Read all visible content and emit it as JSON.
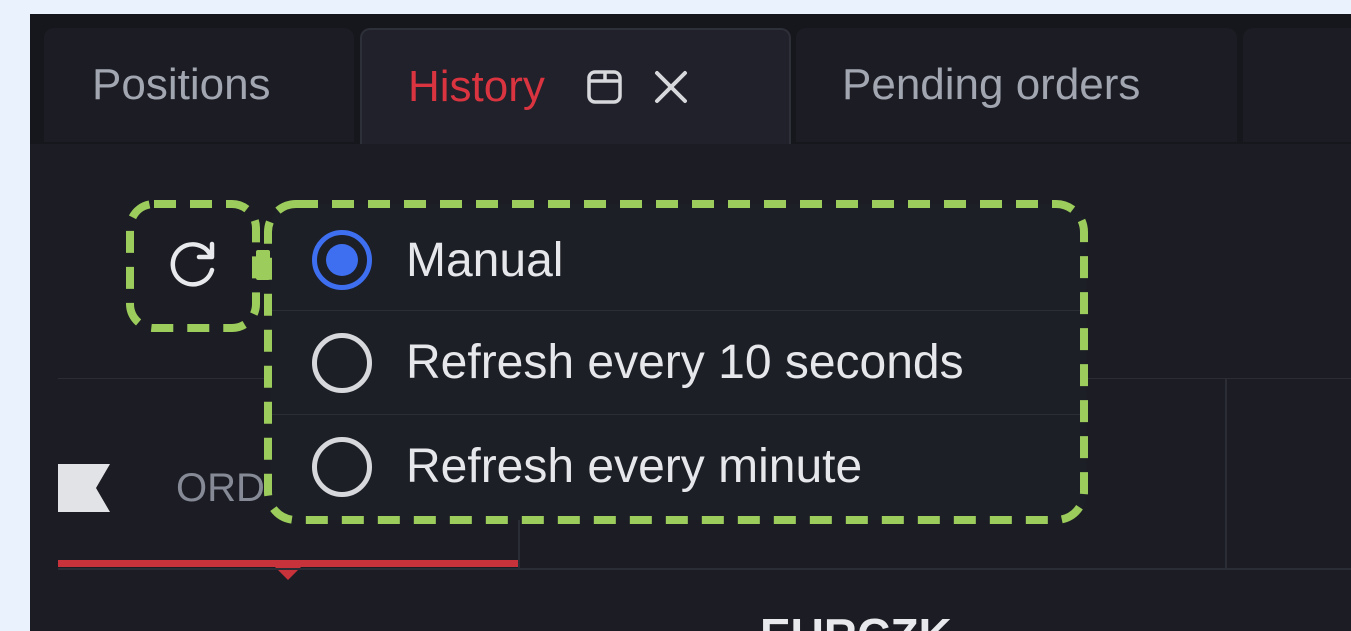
{
  "tabs": [
    {
      "label": "Positions",
      "active": false
    },
    {
      "label": "History",
      "active": true
    },
    {
      "label": "Pending orders",
      "active": false
    }
  ],
  "icons": {
    "refresh": "refresh-icon",
    "popout": "popout-icon",
    "close": "close-icon",
    "flag": "flag-icon"
  },
  "refresh_menu": {
    "options": [
      {
        "label": "Manual",
        "selected": true
      },
      {
        "label": "Refresh every 10 seconds",
        "selected": false
      },
      {
        "label": "Refresh every minute",
        "selected": false
      }
    ]
  },
  "table": {
    "column_header": "ORD",
    "symbol": "EURCZK"
  },
  "colors": {
    "accent": "#d93440",
    "selected_radio": "#3d6ff0",
    "highlight_outline": "#9ccc5c",
    "panel_bg": "#1c1d24"
  }
}
